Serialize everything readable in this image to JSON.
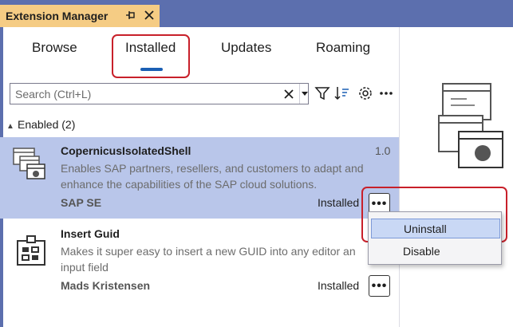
{
  "window": {
    "title": "Extension Manager",
    "pin_icon": "pin-icon",
    "close_icon": "close-icon"
  },
  "tabs": [
    {
      "label": "Browse",
      "selected": false
    },
    {
      "label": "Installed",
      "selected": true
    },
    {
      "label": "Updates",
      "selected": false
    },
    {
      "label": "Roaming",
      "selected": false
    }
  ],
  "search": {
    "placeholder": "Search (Ctrl+L)",
    "value": ""
  },
  "toolbar": {
    "icons": [
      "filter-icon",
      "sort-icon",
      "settings-icon",
      "more-icon"
    ]
  },
  "group": {
    "label": "Enabled (2)"
  },
  "extensions": [
    {
      "name": "CopernicusIsolatedShell",
      "version": "1.0",
      "description_line1": "Enables SAP partners, resellers, and customers to adapt and",
      "description_line2": "enhance the capabilities of the SAP cloud solutions.",
      "author": "SAP SE",
      "status": "Installed",
      "more_label": "•••",
      "selected": true
    },
    {
      "name": "Insert Guid",
      "version": "",
      "description_line1": "Makes it super easy to insert a new GUID into any editor an",
      "description_line2": "input field",
      "author": "Mads Kristensen",
      "status": "Installed",
      "more_label": "•••",
      "selected": false
    }
  ],
  "context_menu": {
    "items": [
      {
        "label": "Uninstall",
        "highlighted": true
      },
      {
        "label": "Disable",
        "highlighted": false
      }
    ]
  },
  "colors": {
    "title_bar": "#5c6fae",
    "tab_active": "#f5cc84",
    "selection": "#b9c6ea",
    "accent": "#1a5fb4",
    "annotation": "#c8202a"
  }
}
